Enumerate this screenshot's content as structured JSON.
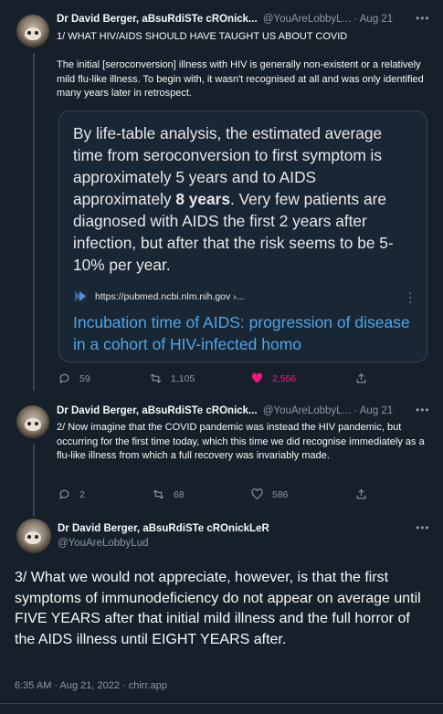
{
  "tweet1": {
    "name": "Dr David Berger, aBsuRdiSTe cROnick...",
    "handle": "@YouAreLobbyL...",
    "separator": "·",
    "date": "Aug 21",
    "more": "•••",
    "line1": "1/ WHAT HIV/AIDS SHOULD HAVE TAUGHT US ABOUT COVID",
    "paragraph": "The initial [seroconversion] illness with HIV is generally non-existent or a relatively mild flu-like illness. To begin with, it wasn't recognised at all and was only identified many years later in retrospect.",
    "card": {
      "quote_before": "By life-table analysis, the estimated average time from seroconversion to first symptom is approximately 5 years and to AIDS approximately ",
      "quote_bold": "8 years",
      "quote_after": ". Very few patients are diagnosed with AIDS the first 2 years after infection, but after that the risk seems to be 5-10% per year.",
      "url": "https://pubmed.ncbi.nlm.nih.gov ›...",
      "title": "Incubation time of AIDS: progression of disease in a cohort of HIV-infected homo"
    },
    "replies": "59",
    "retweets": "1,105",
    "likes": "2,556"
  },
  "tweet2": {
    "name": "Dr David Berger, aBsuRdiSTe cROnick...",
    "handle": "@YouAreLobbyL...",
    "separator": "·",
    "date": "Aug 21",
    "more": "•••",
    "text": "2/ Now imagine that the COVID pandemic was instead the HIV pandemic, but occurring for the first time today, which this time we did recognise immediately as a flu-like illness from which a full recovery was invariably made.",
    "replies": "2",
    "retweets": "68",
    "likes": "586"
  },
  "tweet3": {
    "name": "Dr David Berger, aBsuRdiSTe cROnickLeR",
    "handle": "@YouAreLobbyLud",
    "more": "•••",
    "text": "3/ What we would not appreciate, however, is that the first symptoms of immunodeficiency do not appear on average until FIVE YEARS after that initial mild illness and the full horror of the AIDS illness until EIGHT YEARS after.",
    "footer": "6:35 AM · Aug 21, 2022 · chirr.app"
  },
  "colors": {
    "background": "#15202b",
    "link": "#4fa4e8",
    "like": "#f91880",
    "muted": "#8b98a5"
  }
}
